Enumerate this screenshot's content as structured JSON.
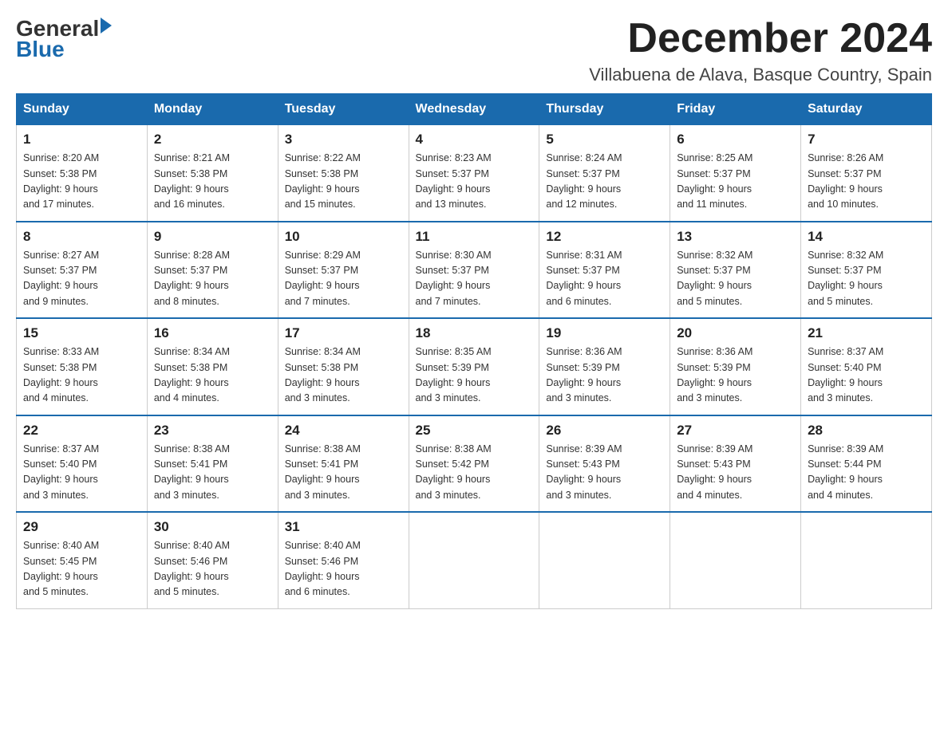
{
  "header": {
    "logo_general": "General",
    "logo_blue": "Blue",
    "month_title": "December 2024",
    "location": "Villabuena de Alava, Basque Country, Spain"
  },
  "weekdays": [
    "Sunday",
    "Monday",
    "Tuesday",
    "Wednesday",
    "Thursday",
    "Friday",
    "Saturday"
  ],
  "weeks": [
    [
      {
        "day": "1",
        "sunrise": "8:20 AM",
        "sunset": "5:38 PM",
        "daylight": "9 hours and 17 minutes."
      },
      {
        "day": "2",
        "sunrise": "8:21 AM",
        "sunset": "5:38 PM",
        "daylight": "9 hours and 16 minutes."
      },
      {
        "day": "3",
        "sunrise": "8:22 AM",
        "sunset": "5:38 PM",
        "daylight": "9 hours and 15 minutes."
      },
      {
        "day": "4",
        "sunrise": "8:23 AM",
        "sunset": "5:37 PM",
        "daylight": "9 hours and 13 minutes."
      },
      {
        "day": "5",
        "sunrise": "8:24 AM",
        "sunset": "5:37 PM",
        "daylight": "9 hours and 12 minutes."
      },
      {
        "day": "6",
        "sunrise": "8:25 AM",
        "sunset": "5:37 PM",
        "daylight": "9 hours and 11 minutes."
      },
      {
        "day": "7",
        "sunrise": "8:26 AM",
        "sunset": "5:37 PM",
        "daylight": "9 hours and 10 minutes."
      }
    ],
    [
      {
        "day": "8",
        "sunrise": "8:27 AM",
        "sunset": "5:37 PM",
        "daylight": "9 hours and 9 minutes."
      },
      {
        "day": "9",
        "sunrise": "8:28 AM",
        "sunset": "5:37 PM",
        "daylight": "9 hours and 8 minutes."
      },
      {
        "day": "10",
        "sunrise": "8:29 AM",
        "sunset": "5:37 PM",
        "daylight": "9 hours and 7 minutes."
      },
      {
        "day": "11",
        "sunrise": "8:30 AM",
        "sunset": "5:37 PM",
        "daylight": "9 hours and 7 minutes."
      },
      {
        "day": "12",
        "sunrise": "8:31 AM",
        "sunset": "5:37 PM",
        "daylight": "9 hours and 6 minutes."
      },
      {
        "day": "13",
        "sunrise": "8:32 AM",
        "sunset": "5:37 PM",
        "daylight": "9 hours and 5 minutes."
      },
      {
        "day": "14",
        "sunrise": "8:32 AM",
        "sunset": "5:37 PM",
        "daylight": "9 hours and 5 minutes."
      }
    ],
    [
      {
        "day": "15",
        "sunrise": "8:33 AM",
        "sunset": "5:38 PM",
        "daylight": "9 hours and 4 minutes."
      },
      {
        "day": "16",
        "sunrise": "8:34 AM",
        "sunset": "5:38 PM",
        "daylight": "9 hours and 4 minutes."
      },
      {
        "day": "17",
        "sunrise": "8:34 AM",
        "sunset": "5:38 PM",
        "daylight": "9 hours and 3 minutes."
      },
      {
        "day": "18",
        "sunrise": "8:35 AM",
        "sunset": "5:39 PM",
        "daylight": "9 hours and 3 minutes."
      },
      {
        "day": "19",
        "sunrise": "8:36 AM",
        "sunset": "5:39 PM",
        "daylight": "9 hours and 3 minutes."
      },
      {
        "day": "20",
        "sunrise": "8:36 AM",
        "sunset": "5:39 PM",
        "daylight": "9 hours and 3 minutes."
      },
      {
        "day": "21",
        "sunrise": "8:37 AM",
        "sunset": "5:40 PM",
        "daylight": "9 hours and 3 minutes."
      }
    ],
    [
      {
        "day": "22",
        "sunrise": "8:37 AM",
        "sunset": "5:40 PM",
        "daylight": "9 hours and 3 minutes."
      },
      {
        "day": "23",
        "sunrise": "8:38 AM",
        "sunset": "5:41 PM",
        "daylight": "9 hours and 3 minutes."
      },
      {
        "day": "24",
        "sunrise": "8:38 AM",
        "sunset": "5:41 PM",
        "daylight": "9 hours and 3 minutes."
      },
      {
        "day": "25",
        "sunrise": "8:38 AM",
        "sunset": "5:42 PM",
        "daylight": "9 hours and 3 minutes."
      },
      {
        "day": "26",
        "sunrise": "8:39 AM",
        "sunset": "5:43 PM",
        "daylight": "9 hours and 3 minutes."
      },
      {
        "day": "27",
        "sunrise": "8:39 AM",
        "sunset": "5:43 PM",
        "daylight": "9 hours and 4 minutes."
      },
      {
        "day": "28",
        "sunrise": "8:39 AM",
        "sunset": "5:44 PM",
        "daylight": "9 hours and 4 minutes."
      }
    ],
    [
      {
        "day": "29",
        "sunrise": "8:40 AM",
        "sunset": "5:45 PM",
        "daylight": "9 hours and 5 minutes."
      },
      {
        "day": "30",
        "sunrise": "8:40 AM",
        "sunset": "5:46 PM",
        "daylight": "9 hours and 5 minutes."
      },
      {
        "day": "31",
        "sunrise": "8:40 AM",
        "sunset": "5:46 PM",
        "daylight": "9 hours and 6 minutes."
      },
      null,
      null,
      null,
      null
    ]
  ]
}
